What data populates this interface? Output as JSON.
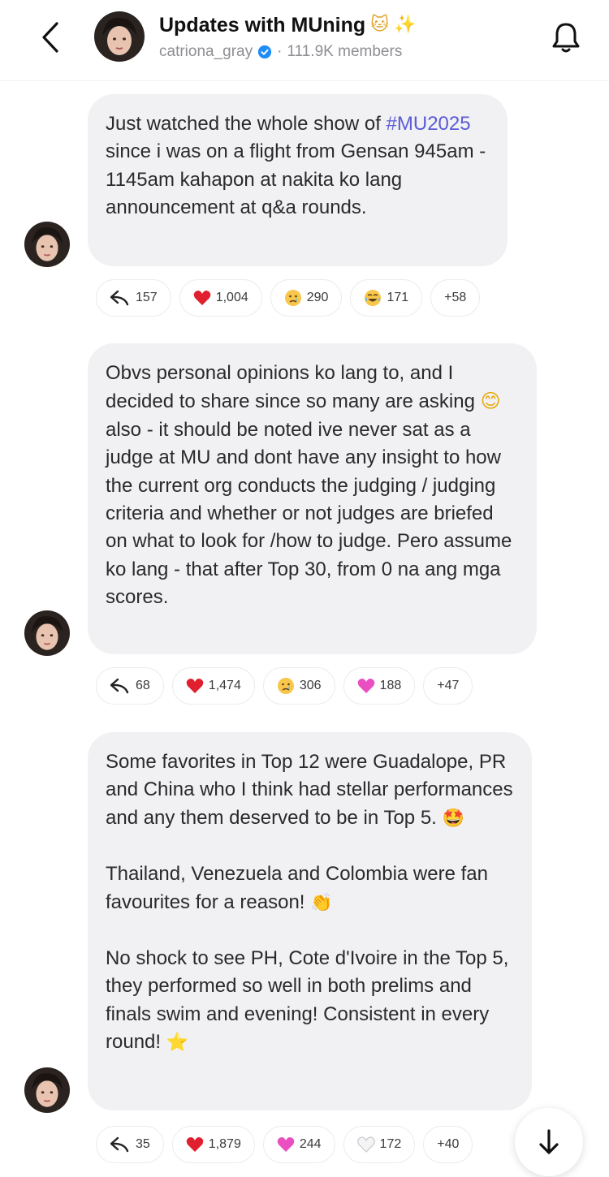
{
  "header": {
    "title": "Updates with MUning",
    "title_emojis": [
      "🐱",
      "✨"
    ],
    "owner": "catriona_gray",
    "member_count": "111.9K members",
    "separator": "·"
  },
  "messages": [
    {
      "text_before": "Just watched the whole show of ",
      "hashtag": "#MU2025",
      "text_after": " since i was on a flight from Gensan 945am - 1145am kahapon at nakita ko lang announcement at q&a rounds.",
      "reactions": [
        {
          "icon": "reply-icon",
          "count": "157"
        },
        {
          "icon": "red-heart-emoji",
          "emoji": "❤️",
          "count": "1,004"
        },
        {
          "icon": "crying-face-emoji",
          "emoji": "😢",
          "count": "290"
        },
        {
          "icon": "tears-of-joy-emoji",
          "emoji": "😂",
          "count": "171"
        },
        {
          "icon": "more",
          "count": "+58"
        }
      ]
    },
    {
      "text_before": "Obvs personal opinions ko lang to, and I decided to share since so many are asking ",
      "emoji_inline": "😊",
      "text_after": " also - it should be noted ive never sat as a judge at MU and dont have any insight to how the current org conducts the judging / judging criteria and whether or not judges are briefed on what to look for /how to judge. Pero assume ko lang - that after Top 30, from 0 na ang mga scores.",
      "reactions": [
        {
          "icon": "reply-icon",
          "count": "68"
        },
        {
          "icon": "red-heart-emoji",
          "emoji": "❤️",
          "count": "1,474"
        },
        {
          "icon": "crying-face-emoji",
          "emoji": "😢",
          "count": "306"
        },
        {
          "icon": "pink-heart-emoji",
          "emoji": "💗",
          "count": "188"
        },
        {
          "icon": "more",
          "count": "+47"
        }
      ]
    },
    {
      "paragraphs": [
        {
          "text": "Some favorites in Top 12 were Guadalope, PR and China who I think had stellar performances and any them deserved to be in Top 5. ",
          "emoji": "🤩"
        },
        {
          "text": "Thailand, Venezuela and Colombia were fan favourites for a reason! ",
          "emoji": "👏"
        },
        {
          "text": "No shock to see PH, Cote d'Ivoire in the Top 5, they performed so well in both prelims and finals swim and evening! Consistent in every round! ",
          "emoji": "⭐"
        }
      ],
      "reactions": [
        {
          "icon": "reply-icon",
          "count": "35"
        },
        {
          "icon": "red-heart-emoji",
          "emoji": "❤️",
          "count": "1,879"
        },
        {
          "icon": "pink-heart-emoji",
          "emoji": "💗",
          "count": "244"
        },
        {
          "icon": "white-heart-emoji",
          "emoji": "🤍",
          "count": "172"
        },
        {
          "icon": "more",
          "count": "+40"
        }
      ]
    }
  ],
  "colors": {
    "bubble": "#f1f1f3",
    "hashtag": "#5b5bd6",
    "verified": "#1d8cf8",
    "heart": "#e0202e",
    "pink_heart": "#e94fc0"
  }
}
